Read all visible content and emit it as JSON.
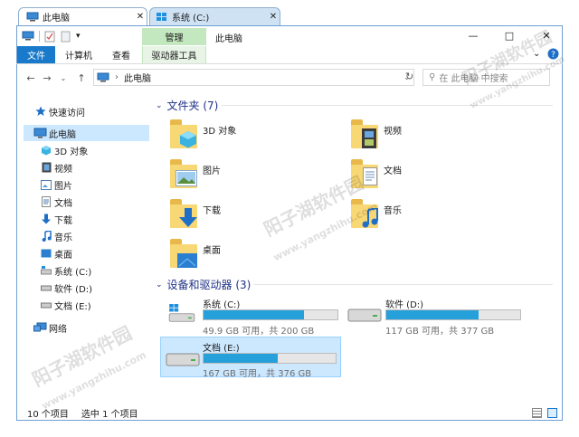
{
  "tabs": [
    {
      "label": "此电脑",
      "active": true
    },
    {
      "label": "系统 (C:)",
      "active": false
    }
  ],
  "window": {
    "title": "此电脑",
    "context_tab": "管理",
    "controls": {
      "minimize": "—",
      "maximize": "□",
      "close": "✕"
    }
  },
  "ribbon": {
    "tabs": [
      "文件",
      "计算机",
      "查看",
      "驱动器工具"
    ]
  },
  "address": {
    "path": "此电脑",
    "search_placeholder": "在 此电脑 中搜索"
  },
  "sidebar": {
    "items": [
      {
        "label": "快速访问",
        "icon": "star-icon"
      },
      {
        "label": "此电脑",
        "icon": "computer-icon",
        "selected": true
      },
      {
        "label": "3D 对象",
        "icon": "cube-icon"
      },
      {
        "label": "视频",
        "icon": "video-icon"
      },
      {
        "label": "图片",
        "icon": "picture-icon"
      },
      {
        "label": "文档",
        "icon": "document-icon"
      },
      {
        "label": "下载",
        "icon": "download-icon"
      },
      {
        "label": "音乐",
        "icon": "music-icon"
      },
      {
        "label": "桌面",
        "icon": "desktop-icon"
      },
      {
        "label": "系统 (C:)",
        "icon": "drive-icon"
      },
      {
        "label": "软件 (D:)",
        "icon": "drive-icon"
      },
      {
        "label": "文档 (E:)",
        "icon": "drive-icon"
      },
      {
        "label": "网络",
        "icon": "network-icon"
      }
    ]
  },
  "folders_group": {
    "title": "文件夹 (7)",
    "items": [
      "3D 对象",
      "视频",
      "图片",
      "文档",
      "下载",
      "音乐",
      "桌面"
    ]
  },
  "drives_group": {
    "title": "设备和驱动器 (3)",
    "drives": [
      {
        "name": "系统 (C:)",
        "info": "49.9 GB 可用，共 200 GB",
        "used_fraction": 0.75
      },
      {
        "name": "软件 (D:)",
        "info": "117 GB 可用，共 377 GB",
        "used_fraction": 0.69
      },
      {
        "name": "文档 (E:)",
        "info": "167 GB 可用，共 376 GB",
        "used_fraction": 0.56,
        "selected": true
      }
    ]
  },
  "status": {
    "count": "10 个项目",
    "selection": "选中 1 个项目"
  },
  "watermark": {
    "name": "阳子湖软件园",
    "url": "www.yangzhihu.com"
  },
  "colors": {
    "accent": "#1979ca",
    "drive_bar": "#26a0da",
    "context_tab": "#c3e7be",
    "selection": "#cce8ff"
  }
}
